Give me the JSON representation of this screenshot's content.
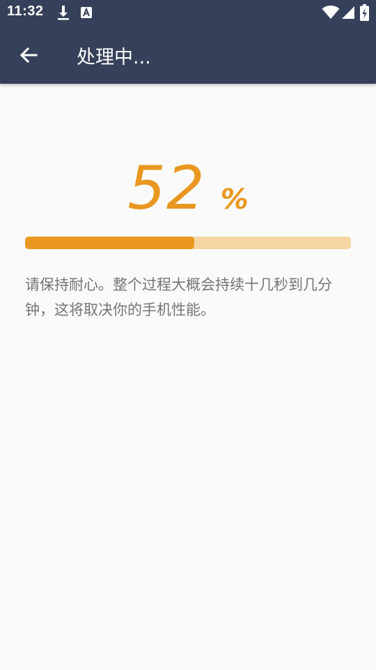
{
  "status_bar": {
    "time": "11:32",
    "icons": [
      "download-icon",
      "a-notification-icon",
      "wifi-icon",
      "signal-icon",
      "battery-charging-icon"
    ]
  },
  "app_bar": {
    "back_icon": "arrow-back-icon",
    "title": "处理中..."
  },
  "progress": {
    "percent_value": "52",
    "percent_sign": "%",
    "fraction": 0.52
  },
  "message": "请保持耐心。整个过程大概会持续十几秒到几分钟，这将取决你的手机性能。",
  "colors": {
    "bar_bg": "#36405a",
    "accent": "#e99720",
    "track": "#f5d6a2",
    "text": "#757575",
    "background": "#fafafa"
  }
}
